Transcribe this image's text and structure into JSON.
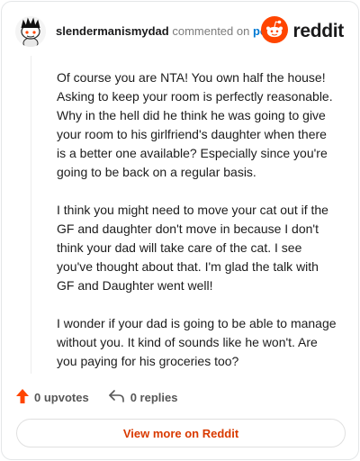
{
  "header": {
    "username": "slendermanismydad",
    "commented_text": "commented on",
    "post_link": "post",
    "brand_name": "reddit"
  },
  "comment": {
    "paragraphs": [
      "Of course you are NTA! You own half the house! Asking to keep your room is perfectly reasonable. Why in the hell did he think he was going to give your room to his girlfriend's daughter when there is a better one available? Especially since you're going to be back on a regular basis.",
      "I think you might need to move your cat out if the GF and daughter don't move in because I don't think your dad will take care of the cat. I see you've thought about that. I'm glad the talk with GF and Daughter went well!",
      "I wonder if your dad is going to be able to manage without you. It kind of sounds like he won't. Are you paying for his groceries too?"
    ]
  },
  "actions": {
    "upvotes_label": "0 upvotes",
    "replies_label": "0 replies"
  },
  "footer": {
    "view_button_label": "View more on Reddit"
  },
  "colors": {
    "brand_orange": "#ff4500",
    "upvote_orange": "#ff4500",
    "link_blue": "#0079d3",
    "button_text": "#d93a00"
  },
  "icons": {
    "avatar": "snoo-avatar-icon",
    "brand": "reddit-logo-icon",
    "upvote": "upvote-arrow-icon",
    "reply": "reply-arrow-icon"
  }
}
